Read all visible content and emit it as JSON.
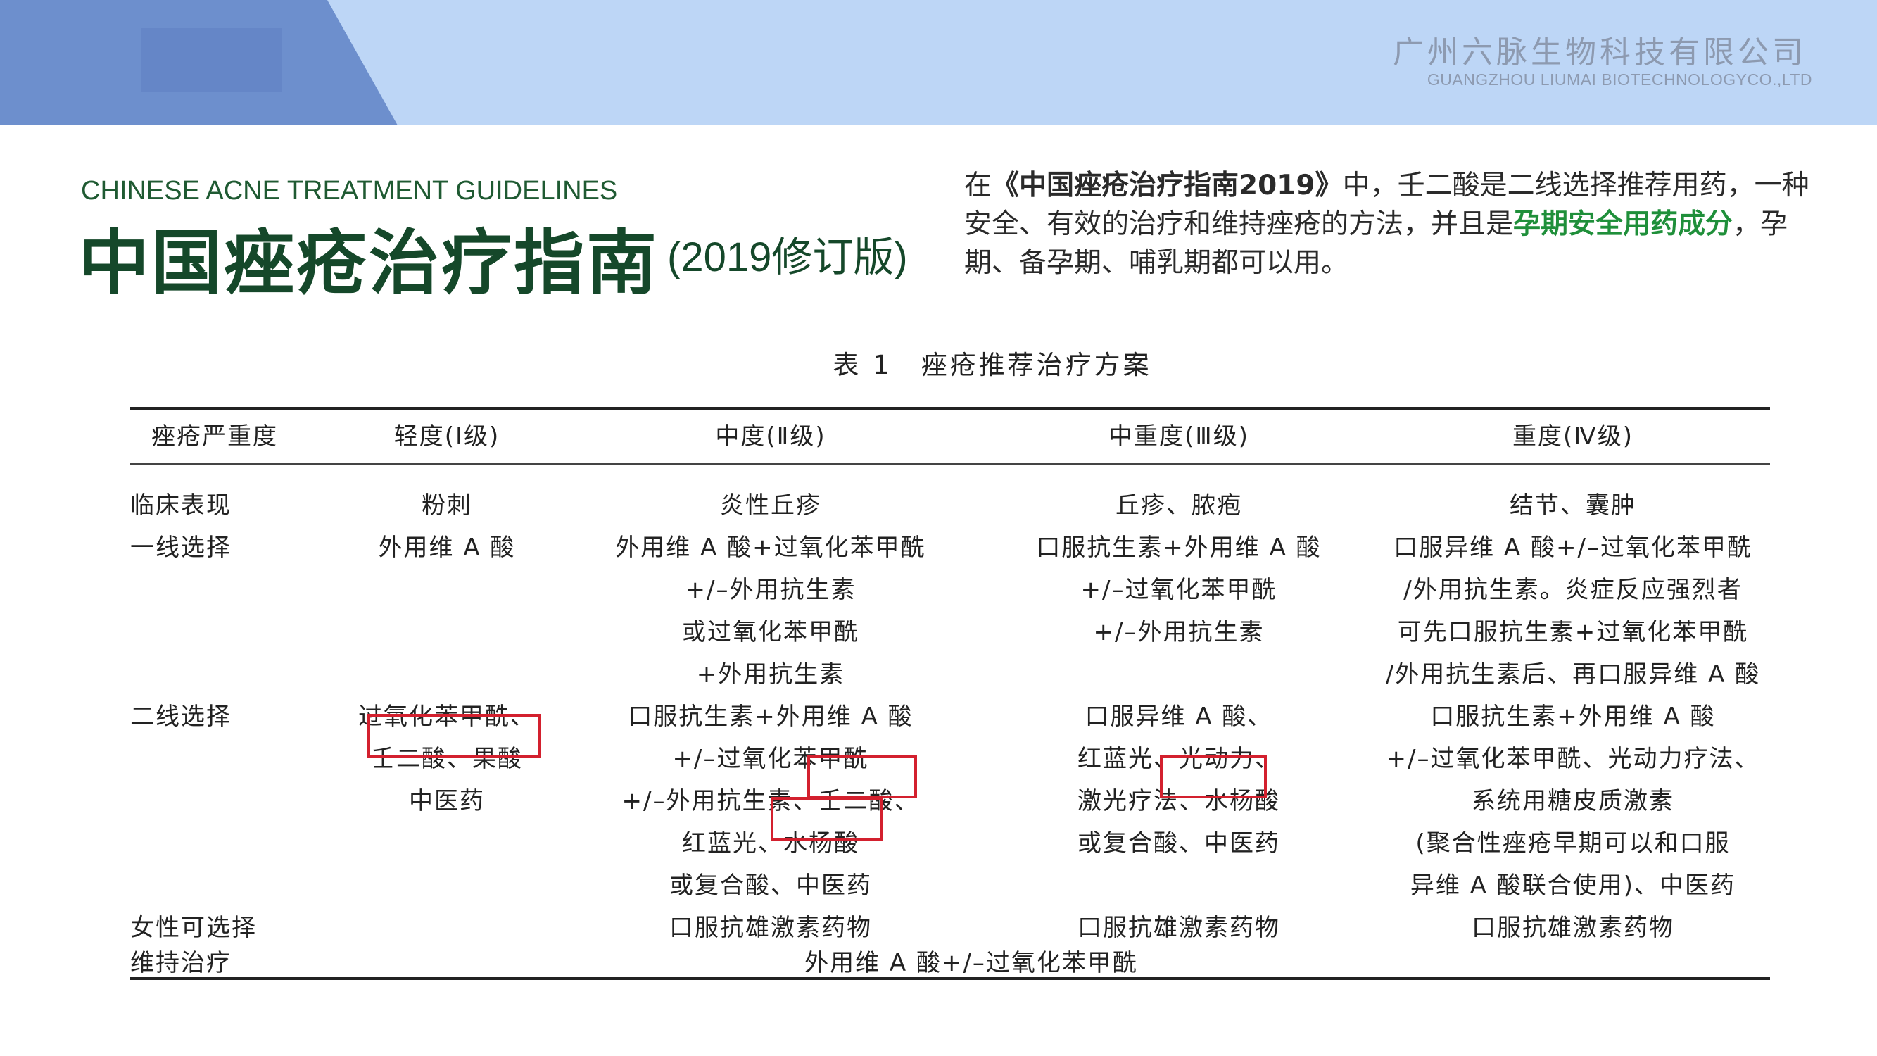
{
  "header": {
    "company_cn": "广州六脉生物科技有限公司",
    "company_en": "GUANGZHOU LIUMAI BIOTECHNOLOGYCO.,LTD",
    "accent_color": "#6d8fcd",
    "band_color": "#bdd6f6"
  },
  "title": {
    "en": "CHINESE ACNE TREATMENT GUIDELINES",
    "cn": "中国痤疮治疗指南",
    "cn_sub": "(2019修订版)",
    "color": "#15482a"
  },
  "intro": {
    "part1": "在",
    "part2": "《中国痤疮治疗指南2019》",
    "part3": "中，壬二酸是二线选择推荐用药，一种安全、有效的治疗和维持痤疮的方法，并且是",
    "highlight": "孕期安全用药成分",
    "part4": "，孕期、备孕期、哺乳期都可以用。",
    "highlight_color": "#1f8f3a"
  },
  "table": {
    "caption": "表 1　痤疮推荐治疗方案",
    "headers": [
      "痤疮严重度",
      "轻度(Ⅰ级)",
      "中度(Ⅱ级)",
      "中重度(Ⅲ级)",
      "重度(Ⅳ级)"
    ],
    "rows": {
      "clinical": {
        "label": "临床表现",
        "c1": "粉刺",
        "c2": "炎性丘疹",
        "c3": "丘疹、脓疱",
        "c4": "结节、囊肿"
      },
      "first_line": {
        "label": "一线选择",
        "c1": [
          "外用维 A 酸"
        ],
        "c2": [
          "外用维 A 酸+过氧化苯甲酰",
          "+/–外用抗生素",
          "或过氧化苯甲酰",
          "+外用抗生素"
        ],
        "c3": [
          "口服抗生素+外用维 A 酸",
          "+/–过氧化苯甲酰",
          "+/–外用抗生素"
        ],
        "c4": [
          "口服异维 A 酸+/–过氧化苯甲酰",
          "/外用抗生素。炎症反应强烈者",
          "可先口服抗生素+过氧化苯甲酰",
          "/外用抗生素后、再口服异维 A 酸"
        ]
      },
      "second_line": {
        "label": "二线选择",
        "c1": [
          "过氧化苯甲酰、",
          "壬二酸、果酸",
          "中医药"
        ],
        "c2": [
          "口服抗生素+外用维 A 酸",
          "+/–过氧化苯甲酰",
          "+/–外用抗生素、壬二酸、",
          "红蓝光、水杨酸",
          "或复合酸、中医药"
        ],
        "c3": [
          "口服异维 A 酸、",
          "红蓝光、光动力、",
          "激光疗法、水杨酸",
          "或复合酸、中医药"
        ],
        "c4": [
          "口服抗生素+外用维 A 酸",
          "+/–过氧化苯甲酰、光动力疗法、",
          "系统用糖皮质激素",
          "(聚合性痤疮早期可以和口服",
          "异维 A 酸联合使用)、中医药"
        ]
      },
      "female": {
        "label": "女性可选择",
        "c2": "口服抗雄激素药物",
        "c3": "口服抗雄激素药物",
        "c4": "口服抗雄激素药物"
      },
      "maintenance": {
        "label": "维持治疗",
        "span": "外用维 A 酸+/–过氧化苯甲酰"
      }
    },
    "highlight_box_color": "#d3202e"
  }
}
